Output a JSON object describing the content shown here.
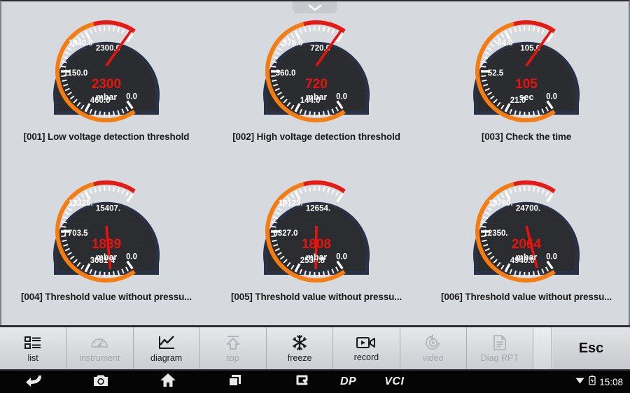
{
  "window": {
    "background_color": "#d6d9dd",
    "handle_icon": "chevron-down-icon"
  },
  "gauges": [
    {
      "id": "001",
      "caption": "[001] Low voltage detection threshold",
      "value": "2300",
      "value_num": 2300,
      "unit": "mbar",
      "min": 0,
      "max": 2300,
      "tick_labels": [
        "0.0",
        "460.0",
        "1150.0",
        "1840.0",
        "2300.0"
      ],
      "tick_values": [
        0,
        460,
        1150,
        1840,
        2300
      ]
    },
    {
      "id": "002",
      "caption": "[002] High voltage detection threshold",
      "value": "720",
      "value_num": 720,
      "unit": "mbar",
      "min": 0,
      "max": 720,
      "tick_labels": [
        "0.0",
        "144.0",
        "360.0",
        "576.0",
        "720.0"
      ],
      "tick_values": [
        0,
        144,
        360,
        576,
        720
      ]
    },
    {
      "id": "003",
      "caption": "[003] Check the time",
      "value": "105",
      "value_num": 105,
      "unit": "sec",
      "min": 0,
      "max": 105,
      "tick_labels": [
        "0.0",
        "21.0",
        "52.5",
        "84.0",
        "105.0"
      ],
      "tick_values": [
        0,
        21,
        52.5,
        84,
        105
      ]
    },
    {
      "id": "004",
      "caption": "[004] Threshold value without pressu...",
      "value": "1839",
      "value_num": 1839,
      "unit": "mbar",
      "min": 0,
      "max": 15407,
      "tick_labels": [
        "0.0",
        "3081.4",
        "7703.5",
        "12325.",
        "15407."
      ],
      "tick_values": [
        0,
        3081.4,
        7703.5,
        12325,
        15407
      ]
    },
    {
      "id": "005",
      "caption": "[005] Threshold value without pressu...",
      "value": "1808",
      "value_num": 1808,
      "unit": "mbar",
      "min": 0,
      "max": 12654,
      "tick_labels": [
        "0.0",
        "2530.8",
        "6327.0",
        "10123.",
        "12654."
      ],
      "tick_values": [
        0,
        2530.8,
        6327,
        10123,
        12654
      ]
    },
    {
      "id": "006",
      "caption": "[006] Threshold value without pressu...",
      "value": "2064",
      "value_num": 2064,
      "unit": "mbar",
      "min": 0,
      "max": 24700,
      "tick_labels": [
        "0.0",
        "4940.0",
        "12350.",
        "19760.",
        "24700."
      ],
      "tick_values": [
        0,
        4940,
        12350,
        19760,
        24700
      ]
    }
  ],
  "toolbar": {
    "items": [
      {
        "label": "list",
        "icon": "list-icon",
        "enabled": true
      },
      {
        "label": "instrument",
        "icon": "gauge-icon",
        "enabled": false
      },
      {
        "label": "diagram",
        "icon": "chart-icon",
        "enabled": true
      },
      {
        "label": "top",
        "icon": "arrow-up-icon",
        "enabled": false
      },
      {
        "label": "freeze",
        "icon": "snowflake-icon",
        "enabled": true
      },
      {
        "label": "record",
        "icon": "camcorder-icon",
        "enabled": true
      },
      {
        "label": "video",
        "icon": "replay-icon",
        "enabled": false
      },
      {
        "label": "Diag RPT",
        "icon": "document-icon",
        "enabled": false
      }
    ],
    "esc_label": "Esc"
  },
  "navbar": {
    "buttons": [
      "back-icon",
      "camera-icon",
      "home-icon",
      "recents-icon",
      "rotate-icon"
    ],
    "brand": "DP",
    "vci": "VCI",
    "status": {
      "wifi_icon": "wifi-icon",
      "battery_icon": "battery-icon",
      "clock": "15:08"
    }
  },
  "colors": {
    "gauge_bezel": "#2b3145",
    "gauge_face": "#2f3034",
    "arc_orange": "#f47c10",
    "arc_red": "#e61a14",
    "needle": "#e8140c",
    "value_text": "#e8140c",
    "tick_white": "#ffffff",
    "page_bg": "#d6d9dd"
  }
}
